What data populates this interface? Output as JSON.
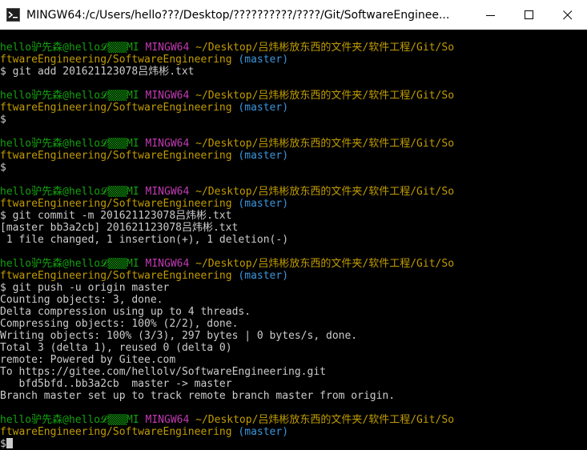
{
  "window": {
    "title": "MINGW64:/c/Users/hello???/Desktop/??????????/????/Git/SoftwareEnginee...",
    "minimize_label": "minimize",
    "maximize_label": "maximize",
    "close_label": "close"
  },
  "prompt": {
    "user": "hello驴先森@hello",
    "host_fragment": "𝓛▒▒▒MI",
    "env": "MINGW64",
    "path_line1": "~/Desktop/吕炜彬放东西的文件夹/软件工程/Git/So",
    "path_line2": "ftwareEngineering/SoftwareEngineering",
    "branch": "(master)",
    "symbol": "$"
  },
  "blocks": [
    {
      "command": " git add 201621123078吕炜彬.txt",
      "output": []
    },
    {
      "command": "",
      "output": []
    },
    {
      "command": "",
      "output": []
    },
    {
      "command": " git commit -m 201621123078吕炜彬.txt",
      "output": [
        "[master bb3a2cb] 201621123078吕炜彬.txt",
        " 1 file changed, 1 insertion(+), 1 deletion(-)"
      ]
    },
    {
      "command": " git push -u origin master",
      "output": [
        "Counting objects: 3, done.",
        "Delta compression using up to 4 threads.",
        "Compressing objects: 100% (2/2), done.",
        "Writing objects: 100% (3/3), 297 bytes | 0 bytes/s, done.",
        "Total 3 (delta 1), reused 0 (delta 0)",
        "remote: Powered by Gitee.com",
        "To https://gitee.com/hellolv/SoftwareEngineering.git",
        "   bfd5bfd..bb3a2cb  master -> master",
        "Branch master set up to track remote branch master from origin."
      ]
    },
    {
      "command": "",
      "output": []
    }
  ],
  "colors": {
    "user": "#13a10e",
    "env": "#c239b3",
    "path": "#c19c00",
    "branch": "#3a96dd",
    "text": "#cccccc",
    "background": "#000000"
  }
}
